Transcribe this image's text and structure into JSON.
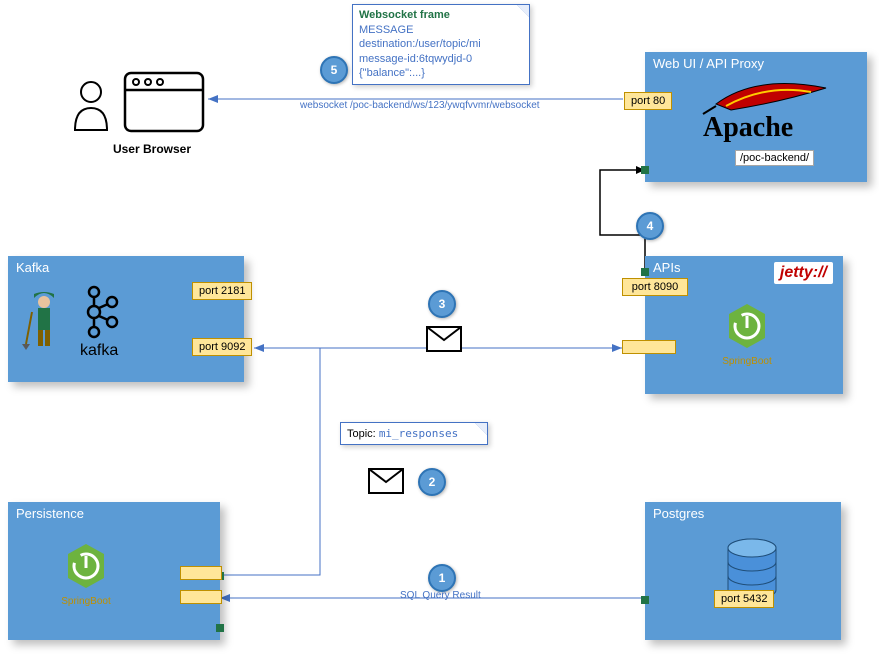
{
  "userBrowser": {
    "caption": "User Browser"
  },
  "webUi": {
    "title": "Web UI / API Proxy",
    "port": "port 80",
    "path": "/poc-backend/",
    "logo": "Apache"
  },
  "kafka": {
    "title": "Kafka",
    "port_zk": "port 2181",
    "port_broker": "port 9092",
    "logo": "kafka"
  },
  "apis": {
    "title": "APIs",
    "port": "port 8090",
    "framework": "SpringBoot",
    "jetty": "jetty://"
  },
  "persistence": {
    "title": "Persistence",
    "framework": "SpringBoot"
  },
  "postgres": {
    "title": "Postgres",
    "port": "port 5432"
  },
  "topicNote": {
    "label": "Topic:",
    "value": "mi_responses"
  },
  "wsNote": {
    "title": "Websocket frame",
    "line1": "MESSAGE",
    "line2": "destination:/user/topic/mi",
    "line3": "message-id:6tqwydjd-0",
    "line4": "{\"balance\":...}"
  },
  "flows": {
    "websocket": "websocket /poc-backend/ws/123/ywqfvvmr/websocket",
    "sql": "SQL Query Result"
  },
  "steps": {
    "s1": "1",
    "s2": "2",
    "s3": "3",
    "s4": "4",
    "s5": "5"
  }
}
